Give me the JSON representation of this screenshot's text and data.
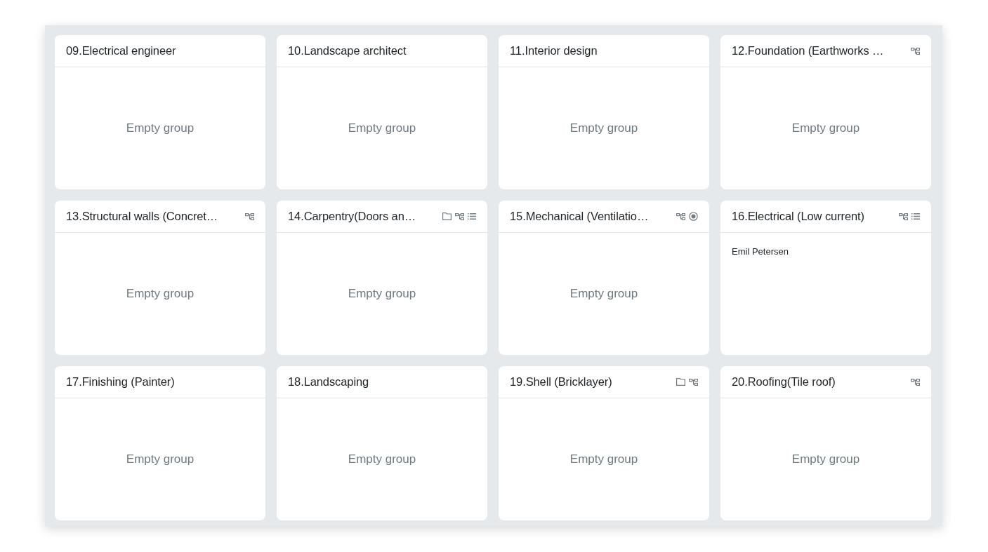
{
  "groups": [
    {
      "title": "09.Electrical engineer",
      "empty_text": "Empty group"
    },
    {
      "title": "10.Landscape architect",
      "empty_text": "Empty group"
    },
    {
      "title": "11.Interior design",
      "empty_text": "Empty group"
    },
    {
      "title": "12.Foundation (Earthworks …",
      "icons": [
        {
          "kind": "hierarchy"
        }
      ],
      "empty_text": "Empty group"
    },
    {
      "title": "13.Structural walls (Concret…",
      "icons": [
        {
          "kind": "hierarchy"
        }
      ],
      "empty_text": "Empty group"
    },
    {
      "title": "14.Carpentry(Doors an…",
      "icons": [
        {
          "kind": "folder"
        },
        {
          "kind": "hierarchy"
        },
        {
          "kind": "list"
        }
      ],
      "empty_text": "Empty group"
    },
    {
      "title": "15.Mechanical (Ventilatio…",
      "icons": [
        {
          "kind": "hierarchy"
        },
        {
          "kind": "radio"
        }
      ],
      "empty_text": "Empty group"
    },
    {
      "title": "16.Electrical (Low current)",
      "icons": [
        {
          "kind": "hierarchy"
        },
        {
          "kind": "list"
        }
      ],
      "members": [
        "Emil Petersen"
      ]
    },
    {
      "title": "17.Finishing (Painter)",
      "empty_text": "Empty group"
    },
    {
      "title": "18.Landscaping",
      "empty_text": "Empty group"
    },
    {
      "title": "19.Shell (Bricklayer)",
      "icons": [
        {
          "kind": "folder"
        },
        {
          "kind": "hierarchy"
        }
      ],
      "empty_text": "Empty group"
    },
    {
      "title": "20.Roofing(Tile roof)",
      "icons": [
        {
          "kind": "hierarchy"
        }
      ],
      "empty_text": "Empty group"
    }
  ]
}
